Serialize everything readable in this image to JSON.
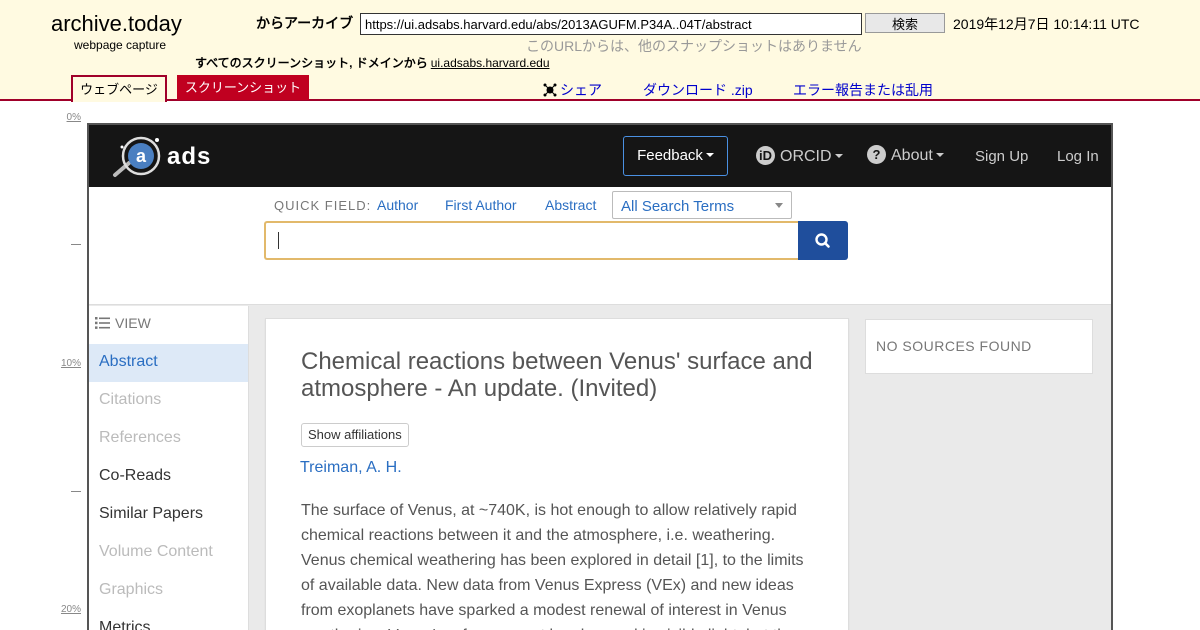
{
  "archive": {
    "logo": "archive.today",
    "subtitle": "webpage capture",
    "from_label": "からアーカイブ",
    "url": "https://ui.adsabs.harvard.edu/abs/2013AGUFM.P34A..04T/abstract",
    "search_button": "検索",
    "timestamp": "2019年12月7日 10:14:11 UTC",
    "no_snapshots": "このURLからは、他のスナップショットはありません",
    "all_screenshots_label": "すべてのスクリーンショット, ドメインから",
    "domain_link": "ui.adsabs.harvard.edu",
    "tabs": [
      {
        "label": "ウェブページ"
      },
      {
        "label": "スクリーンショット"
      }
    ],
    "share": "シェア",
    "download": "ダウンロード .zip",
    "report": "エラー報告または乱用",
    "accent_color": "#a0002a"
  },
  "ruler": [
    "0%",
    "10%",
    "20%"
  ],
  "ads": {
    "brand": "ads",
    "nav": {
      "feedback": "Feedback",
      "orcid": "ORCID",
      "about": "About",
      "signup": "Sign Up",
      "login": "Log In"
    },
    "quick_field": {
      "label": "QUICK FIELD:",
      "links": [
        "Author",
        "First Author",
        "Abstract"
      ],
      "select_value": "All Search Terms"
    },
    "search_input_value": "",
    "sidebar": {
      "heading": "VIEW",
      "items": [
        {
          "label": "Abstract",
          "state": "active"
        },
        {
          "label": "Citations",
          "state": "disabled"
        },
        {
          "label": "References",
          "state": "disabled"
        },
        {
          "label": "Co-Reads",
          "state": "enabled"
        },
        {
          "label": "Similar Papers",
          "state": "enabled"
        },
        {
          "label": "Volume Content",
          "state": "disabled"
        },
        {
          "label": "Graphics",
          "state": "disabled"
        },
        {
          "label": "Metrics",
          "state": "enabled"
        }
      ]
    },
    "paper": {
      "title": "Chemical reactions between Venus' surface and atmosphere - An update. (Invited)",
      "show_affiliations": "Show affiliations",
      "author": "Treiman, A. H.",
      "abstract": "The surface of Venus, at ~740K, is hot enough to allow relatively rapid chemical reactions between it and the atmosphere, i.e. weathering. Venus chemical weathering has been explored in detail [1], to the limits of available data. New data from Venus Express (VEx) and new ideas from exoplanets have sparked a modest renewal of interest in Venus weathering. Venus' surface cannot be observed in visible light, but there"
    },
    "sources": "NO SOURCES FOUND",
    "colors": {
      "link": "#2a6ec2",
      "navbar": "#151515",
      "search_button": "#1f4e9c"
    }
  }
}
